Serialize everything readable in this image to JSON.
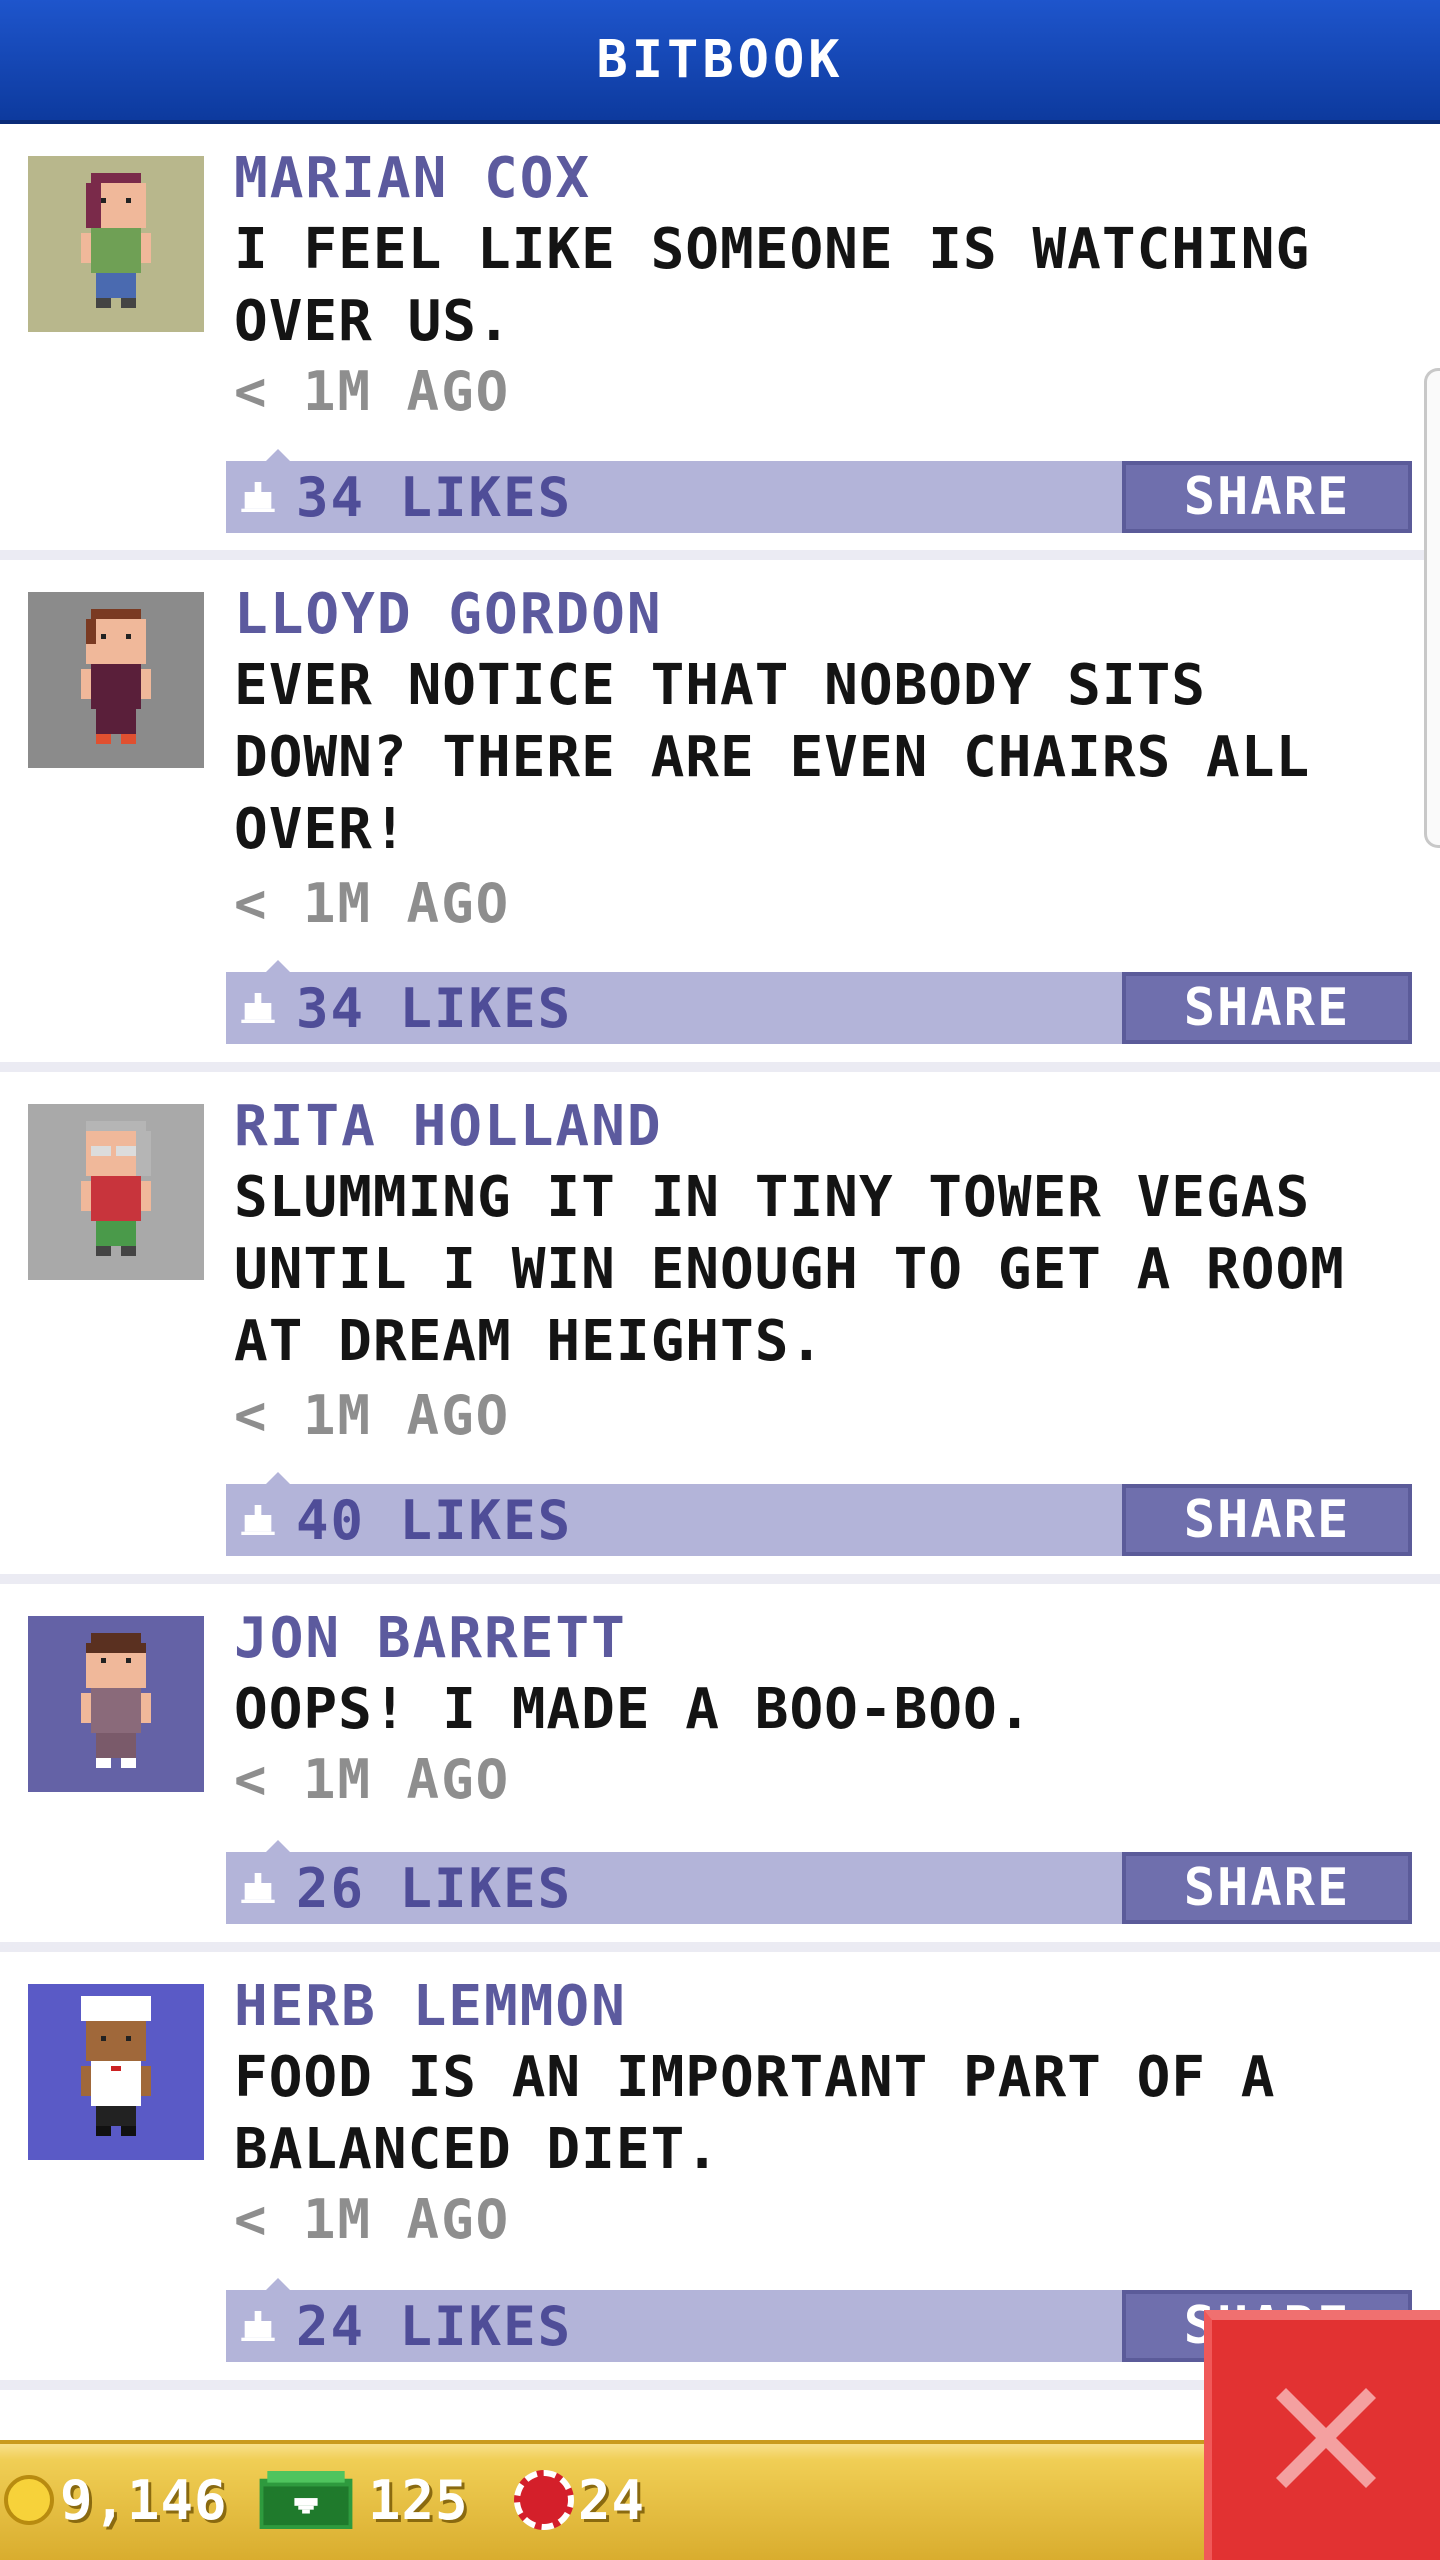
{
  "header": {
    "title": "BITBOOK"
  },
  "posts": [
    {
      "name": "MARIAN COX",
      "text": "I FEEL LIKE SOMEONE IS WATCHING OVER US.",
      "time": "< 1M AGO",
      "likes": "34 LIKES",
      "share": "SHARE",
      "avatar_bg": "#b8b78c",
      "shirt": "#6fa055",
      "hair": "#7a2a4a"
    },
    {
      "name": "LLOYD GORDON",
      "text": "EVER NOTICE THAT NOBODY SITS DOWN? THERE ARE EVEN CHAIRS ALL OVER!",
      "time": "< 1M AGO",
      "likes": "34 LIKES",
      "share": "SHARE",
      "avatar_bg": "#8b8b8b",
      "shirt": "#5a1f3a",
      "hair": "#7a3a22"
    },
    {
      "name": "RITA HOLLAND",
      "text": "SLUMMING IT IN TINY TOWER VEGAS UNTIL I WIN ENOUGH TO GET A ROOM AT DREAM HEIGHTS.",
      "time": "< 1M AGO",
      "likes": "40 LIKES",
      "share": "SHARE",
      "avatar_bg": "#a9a9a9",
      "shirt": "#c8343c",
      "hair": "#b5b5b5"
    },
    {
      "name": "JON BARRETT",
      "text": "OOPS! I MADE A BOO-BOO.",
      "time": "< 1M AGO",
      "likes": "26 LIKES",
      "share": "SHARE",
      "avatar_bg": "#6462a6",
      "shirt": "#8a6a7a",
      "hair": "#5a3020"
    },
    {
      "name": "HERB LEMMON",
      "text": "FOOD IS AN IMPORTANT PART OF A BALANCED DIET.",
      "time": "< 1M AGO",
      "likes": "24 LIKES",
      "share": "SHARE",
      "avatar_bg": "#5a5ac6",
      "shirt": "#ffffff",
      "hair": "#ffffff"
    }
  ],
  "status": {
    "coins": "9,146",
    "bux": "125",
    "chips": "24"
  },
  "colors": {
    "header": "#1e55cc",
    "name": "#5c5a9e",
    "like_bar": "#b3b4d9",
    "share": "#6f6fad",
    "close": "#e23232"
  }
}
